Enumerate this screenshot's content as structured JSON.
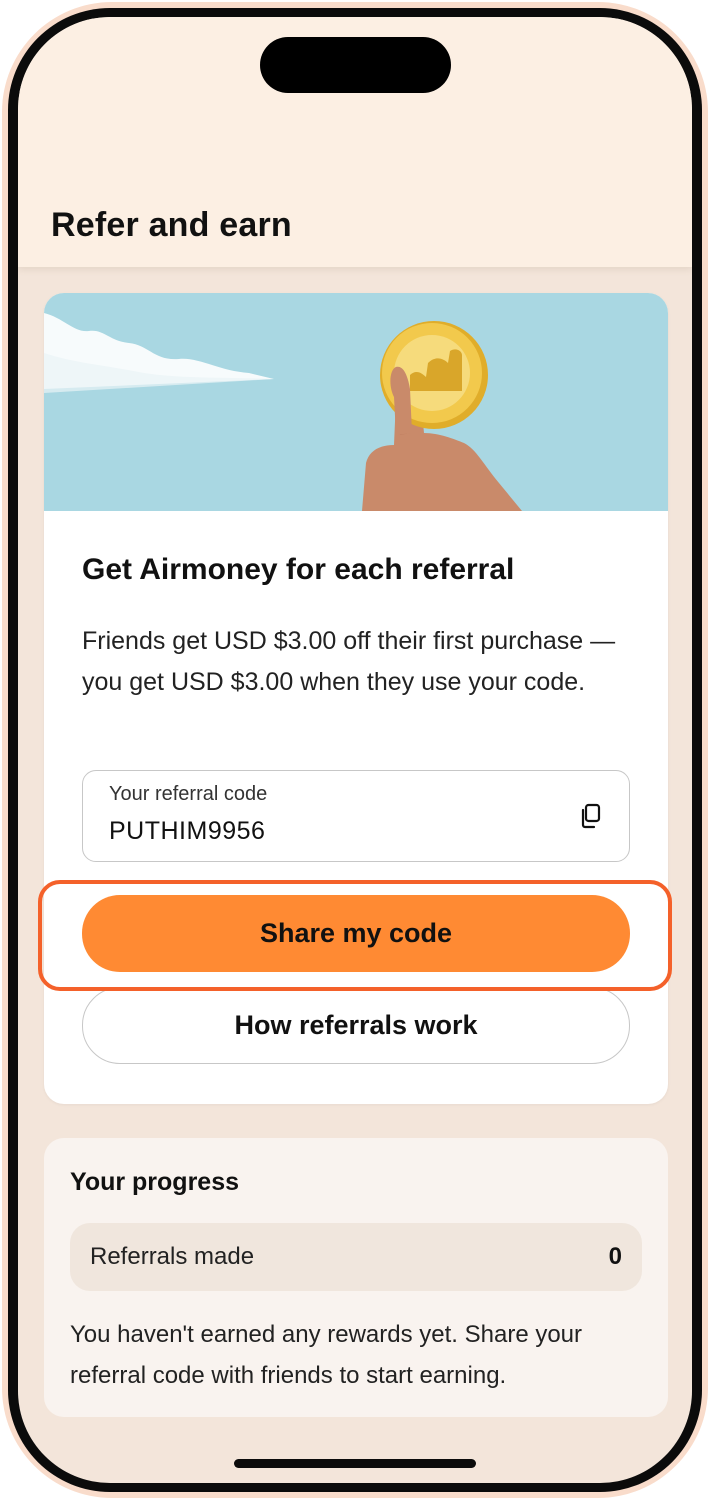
{
  "header": {
    "title": "Refer and earn"
  },
  "referral_card": {
    "title": "Get Airmoney for each referral",
    "description": "Friends get USD $3.00 off their first purchase — you get USD $3.00 when they use your code.",
    "code_field": {
      "label": "Your referral code",
      "value": "PUTHIM9956",
      "copy_icon": "copy-icon"
    },
    "share_button_label": "Share my code",
    "how_button_label": "How referrals work"
  },
  "progress": {
    "title": "Your progress",
    "rows": [
      {
        "label": "Referrals made",
        "value": "0"
      }
    ],
    "note": "You haven't earned any rewards yet. Share your referral code with friends to start earning."
  },
  "colors": {
    "accent": "#ff8a33",
    "highlight": "#f4612a",
    "header_bg": "#fcefe3",
    "page_bg": "#f3e5da",
    "hero_sky": "#a9d7e2",
    "coin": "#f2c94c"
  }
}
